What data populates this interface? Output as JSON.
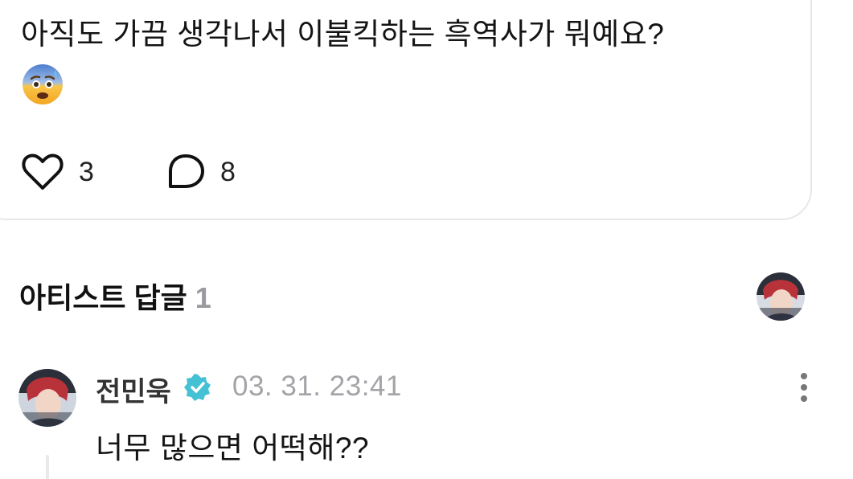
{
  "post": {
    "text": "아직도 가끔 생각나서 이불킥하는 흑역사가 뭐예요?",
    "emoji": "anxious-face-with-sweat",
    "like_count": "3",
    "comment_count": "8"
  },
  "artist_replies": {
    "title": "아티스트 답글",
    "count": "1"
  },
  "reply": {
    "author": "전민욱",
    "timestamp": "03. 31. 23:41",
    "text": "너무 많으면 어떡해??"
  },
  "colors": {
    "verified": "#44c1d4",
    "muted": "#a3a3a8",
    "border": "#e6e7ea"
  }
}
